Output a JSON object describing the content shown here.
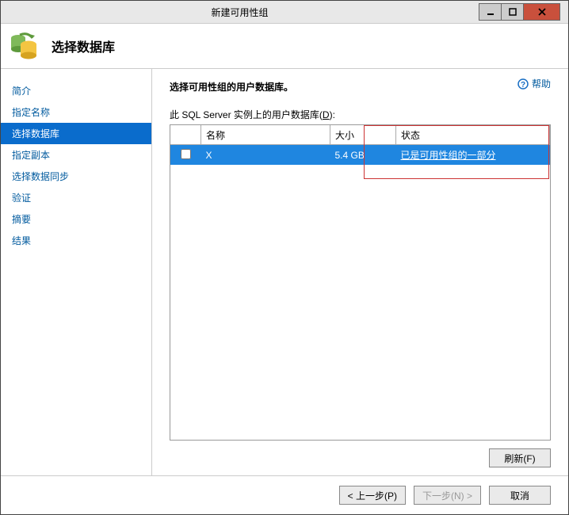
{
  "window": {
    "title": "新建可用性组"
  },
  "header": {
    "page_title": "选择数据库"
  },
  "help": {
    "label": "帮助"
  },
  "sidebar": {
    "items": [
      {
        "label": "简介"
      },
      {
        "label": "指定名称"
      },
      {
        "label": "选择数据库",
        "selected": true
      },
      {
        "label": "指定副本"
      },
      {
        "label": "选择数据同步"
      },
      {
        "label": "验证"
      },
      {
        "label": "摘要"
      },
      {
        "label": "结果"
      }
    ]
  },
  "main": {
    "instruction": "选择可用性组的用户数据库。",
    "list_label_prefix": "此 SQL Server 实例上的用户数据库(",
    "list_label_hotkey": "D",
    "list_label_suffix": "):",
    "columns": {
      "name": "名称",
      "size": "大小",
      "status": "状态"
    },
    "rows": [
      {
        "checked": false,
        "name": "X",
        "size": "5.4 GB",
        "status": "已是可用性组的一部分"
      }
    ],
    "refresh_label": "刷新(F)"
  },
  "footer": {
    "prev": "< 上一步(P)",
    "next": "下一步(N) >",
    "cancel": "取消"
  }
}
